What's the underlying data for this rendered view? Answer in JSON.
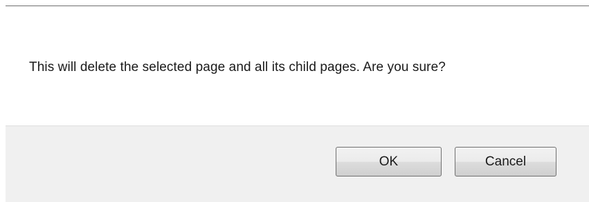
{
  "dialog": {
    "message": "This will delete the selected page and all its child pages. Are you sure?",
    "buttons": {
      "ok_label": "OK",
      "cancel_label": "Cancel"
    }
  }
}
